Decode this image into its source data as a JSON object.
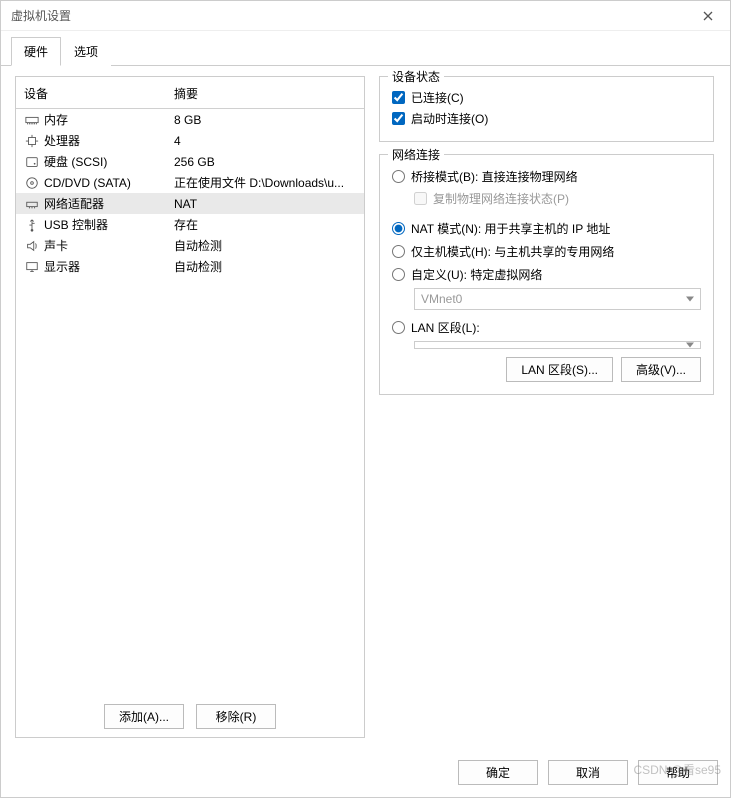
{
  "window": {
    "title": "虚拟机设置"
  },
  "tabs": {
    "hardware": "硬件",
    "options": "选项"
  },
  "hw": {
    "head_device": "设备",
    "head_summary": "摘要",
    "rows": [
      {
        "name": "内存",
        "summary": "8 GB",
        "icon": "memory"
      },
      {
        "name": "处理器",
        "summary": "4",
        "icon": "cpu"
      },
      {
        "name": "硬盘 (SCSI)",
        "summary": "256 GB",
        "icon": "disk"
      },
      {
        "name": "CD/DVD (SATA)",
        "summary": "正在使用文件 D:\\Downloads\\u...",
        "icon": "disc"
      },
      {
        "name": "网络适配器",
        "summary": "NAT",
        "icon": "net",
        "selected": true
      },
      {
        "name": "USB 控制器",
        "summary": "存在",
        "icon": "usb"
      },
      {
        "name": "声卡",
        "summary": "自动检测",
        "icon": "sound"
      },
      {
        "name": "显示器",
        "summary": "自动检测",
        "icon": "display"
      }
    ],
    "add_btn": "添加(A)...",
    "remove_btn": "移除(R)"
  },
  "state": {
    "legend": "设备状态",
    "connected": "已连接(C)",
    "connect_on_power": "启动时连接(O)"
  },
  "net": {
    "legend": "网络连接",
    "bridged": "桥接模式(B): 直接连接物理网络",
    "replicate": "复制物理网络连接状态(P)",
    "nat": "NAT 模式(N): 用于共享主机的 IP 地址",
    "hostonly": "仅主机模式(H): 与主机共享的专用网络",
    "custom": "自定义(U): 特定虚拟网络",
    "custom_value": "VMnet0",
    "lanseg": "LAN 区段(L):",
    "lanseg_value": "",
    "lanseg_btn": "LAN 区段(S)...",
    "advanced_btn": "高级(V)..."
  },
  "dialog": {
    "ok": "确定",
    "cancel": "取消",
    "help": "帮助"
  },
  "watermark": "CSDN @看se95"
}
